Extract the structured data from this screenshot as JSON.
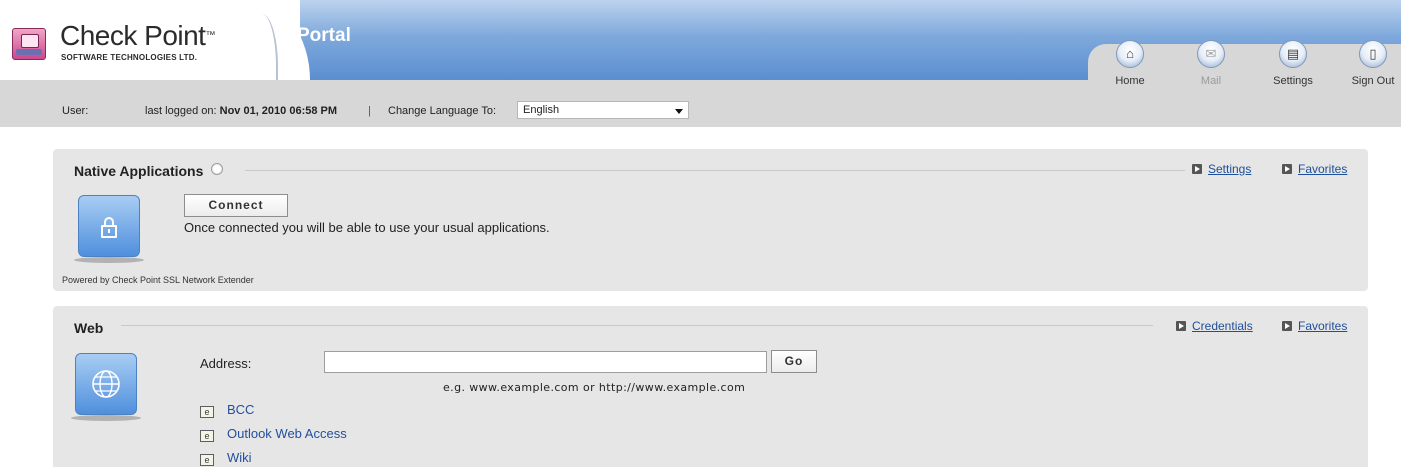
{
  "header": {
    "logo_name": "Check Point",
    "logo_tm": "™",
    "logo_subtitle": "SOFTWARE TECHNOLOGIES LTD.",
    "portal_title": "Portal",
    "nav": [
      {
        "label": "Home",
        "icon": "home-icon",
        "glyph": "⌂",
        "enabled": true
      },
      {
        "label": "Mail",
        "icon": "mail-icon",
        "glyph": "✉",
        "enabled": false
      },
      {
        "label": "Settings",
        "icon": "settings-icon",
        "glyph": "▤",
        "enabled": true
      },
      {
        "label": "Sign Out",
        "icon": "door-icon",
        "glyph": "▯",
        "enabled": true
      }
    ]
  },
  "user_bar": {
    "user_label": "User:",
    "last_logged_prefix": "last logged on:",
    "last_logged_value": "Nov 01, 2010 06:58 PM",
    "separator": "|",
    "language_label": "Change Language To:",
    "language_selected": "English"
  },
  "native_apps": {
    "title": "Native Applications",
    "settings_link": "Settings",
    "favorites_link": "Favorites",
    "connect_button": "Connect",
    "description": "Once connected you will be able to use your usual applications.",
    "powered_by": "Powered by Check Point SSL Network Extender"
  },
  "web": {
    "title": "Web",
    "credentials_link": "Credentials",
    "favorites_link": "Favorites",
    "address_label": "Address:",
    "address_value": "",
    "go_button": "Go",
    "address_hint": "e.g.  www.example.com  or  http://www.example.com",
    "bookmarks": [
      "BCC",
      "Outlook Web Access",
      "Wiki"
    ]
  },
  "colors": {
    "header_band": "#5b8ed0",
    "panel_bg": "#e6e6e6",
    "link": "#1e4f9a"
  }
}
